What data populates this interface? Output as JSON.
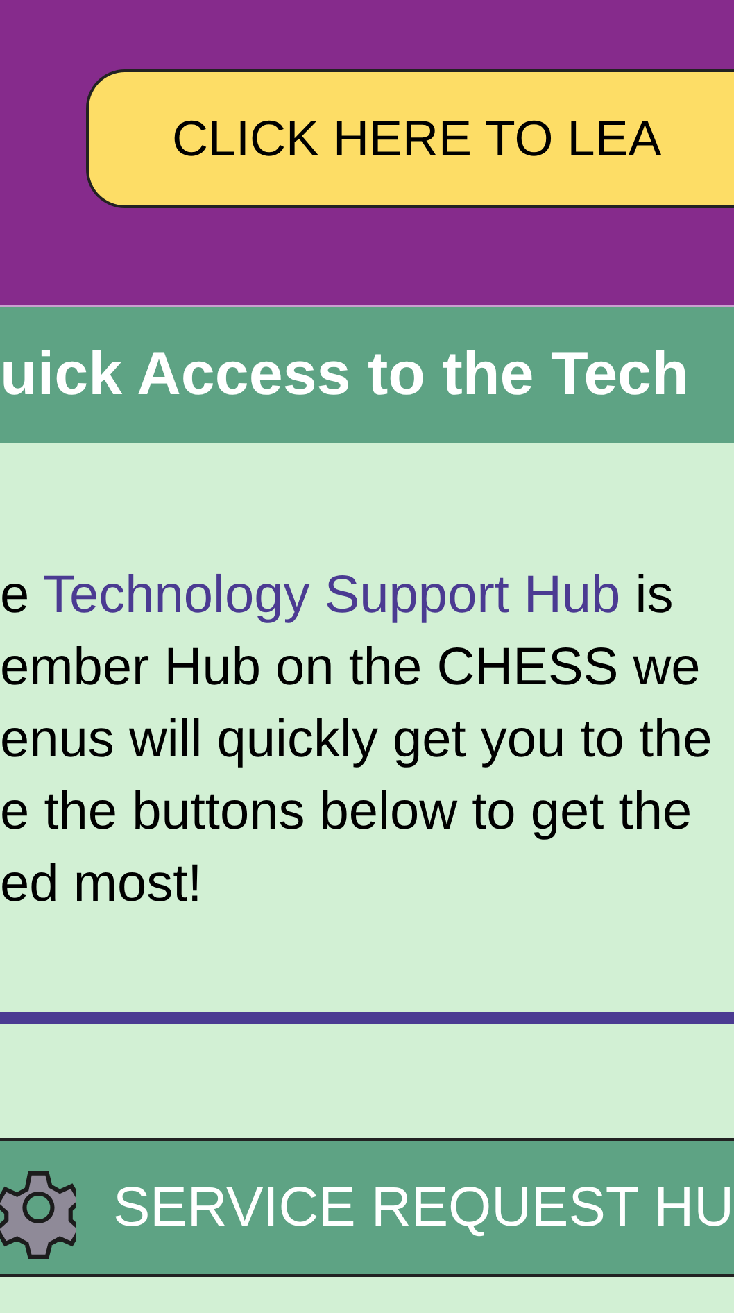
{
  "banner": {
    "button": "CLICK HERE TO LEA"
  },
  "section": {
    "title": "uick Access to the Tech",
    "lines": [
      {
        "before": "e ",
        "link": "Technology Support Hub",
        "after": " is"
      },
      {
        "before": "ember Hub on the CHESS we"
      },
      {
        "before": "enus will quickly get you to the"
      },
      {
        "before": "e the buttons below to get the"
      },
      {
        "before": "ed most!"
      }
    ]
  },
  "hub_buttons": [
    {
      "label": "SERVICE REQUEST HU"
    }
  ]
}
